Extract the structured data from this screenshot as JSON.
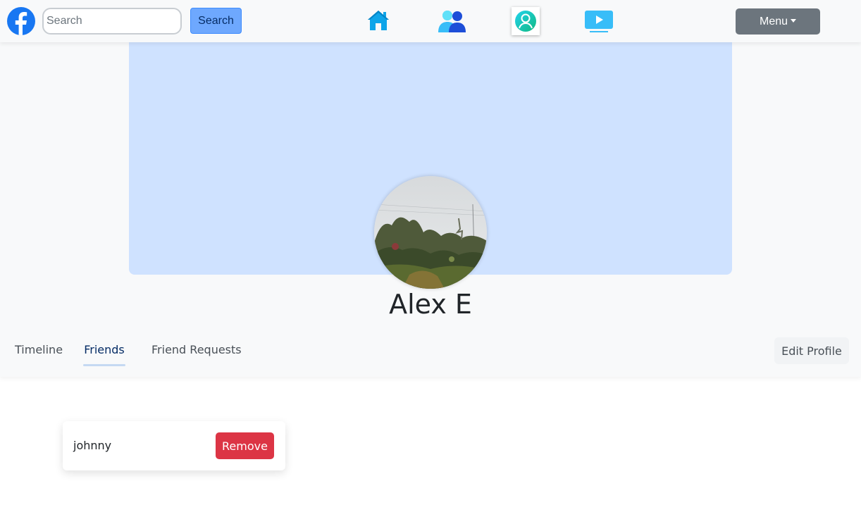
{
  "navbar": {
    "logo_icon": "facebook-logo-icon",
    "search_placeholder": "Search",
    "search_value": "",
    "search_button_label": "Search",
    "nav_icons": [
      "home-icon",
      "friends-icon",
      "profile-icon",
      "watch-video-icon"
    ],
    "menu_label": "Menu"
  },
  "profile": {
    "name": "Alex E",
    "cover_color": "#cfe2ff",
    "avatar": "profile-photo"
  },
  "tabs": [
    {
      "label": "Timeline",
      "active": false
    },
    {
      "label": "Friends",
      "active": true
    },
    {
      "label": "Friend Requests",
      "active": false
    }
  ],
  "edit_profile_label": "Edit Profile",
  "friends": [
    {
      "name": "johnny",
      "action_label": "Remove"
    }
  ],
  "colors": {
    "brand": "#1877f2",
    "search_button": "#6ea8fe",
    "menu_button": "#6c757d",
    "remove_button": "#dc3545",
    "nav_icon": "#0ea5e9"
  }
}
